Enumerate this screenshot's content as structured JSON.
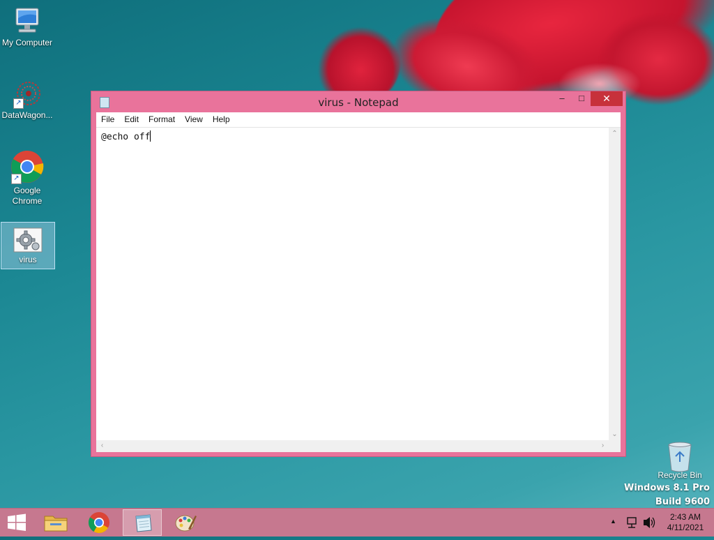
{
  "desktop": {
    "icons": [
      {
        "label": "My Computer"
      },
      {
        "label": "DataWagon..."
      },
      {
        "label": "Google\nChrome",
        "line1": "Google",
        "line2": "Chrome"
      },
      {
        "label": "virus"
      }
    ],
    "recycle_bin": "Recycle Bin",
    "watermark": {
      "line1": "Windows 8.1 Pro",
      "line2": "Build 9600"
    }
  },
  "notepad": {
    "title": "virus - Notepad",
    "menu": [
      "File",
      "Edit",
      "Format",
      "View",
      "Help"
    ],
    "content": "@echo off",
    "buttons": {
      "minimize": "–",
      "maximize": "□",
      "close": "✕"
    }
  },
  "taskbar": {
    "clock_time": "2:43 AM",
    "clock_date": "4/11/2021",
    "tray_arrow": "▲",
    "volume": "🔊",
    "active_app": "notepad"
  },
  "icons": {
    "start": "windows-start-icon",
    "explorer": "file-explorer-icon",
    "chrome": "chrome-icon",
    "notepad": "notepad-icon",
    "paint": "paint-icon"
  },
  "colors": {
    "window_frame": "#e9739b",
    "taskbar": "#c6788f",
    "close_button": "#c7313b"
  }
}
